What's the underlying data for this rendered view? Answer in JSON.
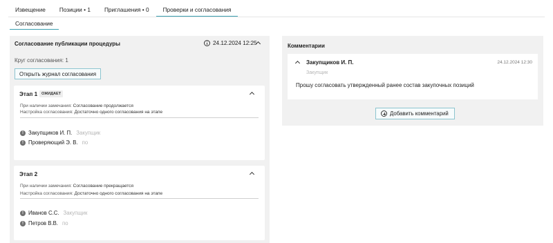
{
  "tabs": [
    {
      "label": "Извещение",
      "active": false
    },
    {
      "label": "Позиции • 1",
      "active": false
    },
    {
      "label": "Приглашения • 0",
      "active": false
    },
    {
      "label": "Проверки и согласования",
      "active": true
    }
  ],
  "subtab": {
    "label": "Согласование"
  },
  "approval": {
    "title": "Согласование публикации процедуры",
    "date": "24.12.2024 12:25",
    "round": "Круг согласования: 1",
    "open_journal_label": "Открыть журнал согласования",
    "stages": [
      {
        "title": "Этап 1",
        "badge": "ОЖИДАЕТ",
        "remark_key": "При наличии замечания:",
        "remark_value": "Согласование продолжается",
        "setting_key": "Настройка согласования:",
        "setting_value": "Достаточно одного согласования на этапе",
        "approvers": [
          {
            "name": "Закупщиков И. П.",
            "role": "Закупщик"
          },
          {
            "name": "Проверяющий Э. В.",
            "role": "по"
          }
        ]
      },
      {
        "title": "Этап 2",
        "badge": "",
        "remark_key": "При наличии замечания:",
        "remark_value": "Согласование прекращается",
        "setting_key": "Настройка согласования:",
        "setting_value": "Достаточно одного согласования на этапе",
        "approvers": [
          {
            "name": "Иванов С.С.",
            "role": "Закупщик"
          },
          {
            "name": "Петров В.В.",
            "role": "по"
          }
        ]
      }
    ]
  },
  "comments": {
    "title": "Комментарии",
    "items": [
      {
        "author": "Закупщиков И. П.",
        "date": "24.12.2024 12:30",
        "role": "Закупщик",
        "text": "Прошу согласовать утвержденный ранее состав закупочных позиций"
      }
    ],
    "add_label": "Добавить комментарий"
  },
  "icons": {
    "info": "info-icon",
    "collapse": "chevron-up-icon",
    "warning": "exclamation-circle-icon",
    "add": "plus-circle-icon"
  },
  "colors": {
    "accent": "#3a9fb0",
    "panel_bg": "#f1f1f1",
    "button_border": "#8cc4cf",
    "muted_text": "#b5b5b5"
  }
}
